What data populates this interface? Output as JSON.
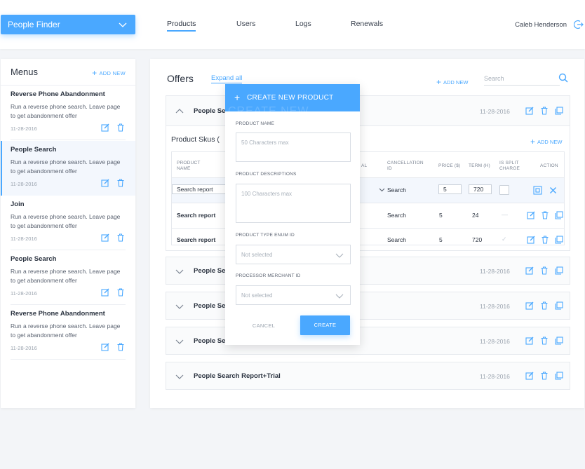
{
  "header": {
    "app_select": "People Finder",
    "tabs": [
      {
        "label": "Products",
        "active": true
      },
      {
        "label": "Users",
        "active": false
      },
      {
        "label": "Logs",
        "active": false
      },
      {
        "label": "Renewals",
        "active": false
      }
    ],
    "user_name": "Caleb Henderson"
  },
  "menus": {
    "title": "Menus",
    "add_label": "ADD NEW",
    "items": [
      {
        "title": "Reverse Phone Abandonment",
        "description": "Run a reverse phone search. Leave page to get abandonment offer",
        "date": "11-28-2016"
      },
      {
        "title": "People Search",
        "description": "Run a reverse phone search. Leave page to get abandonment offer",
        "date": "11-28-2016",
        "active": true
      },
      {
        "title": "Join",
        "description": "Run a reverse phone search. Leave page to get abandonment offer",
        "date": "11-28-2016"
      },
      {
        "title": "People Search",
        "description": "Run a reverse phone search. Leave page to get abandonment offer",
        "date": "11-28-2016"
      },
      {
        "title": "Reverse Phone Abandonment",
        "description": "Run a reverse phone search. Leave page to get abandonment offer",
        "date": "11-28-2016"
      }
    ]
  },
  "offers": {
    "title": "Offers",
    "expand_all": "Expand all",
    "add_label": "ADD NEW",
    "search_placeholder": "Search",
    "rows": [
      {
        "name": "People Se",
        "date": "11-28-2016",
        "expanded": true
      },
      {
        "name": "People Se",
        "date": "11-28-2016"
      },
      {
        "name": "People Se",
        "date": "11-28-2016"
      },
      {
        "name": "People Se",
        "date": "11-28-2016"
      },
      {
        "name": "People Search Report+Trial",
        "date": "11-28-2016"
      }
    ],
    "skus": {
      "title": "Product Skus (",
      "add_label": "ADD NEW",
      "columns": {
        "product_name": "PRODUCT NAME",
        "al": "AL",
        "cancellation_id": "CANCELLATION ID",
        "price": "PRICE ($)",
        "term": "TERM (H)",
        "is_split": "IS SPLIT CHARGE",
        "action": "ACTION"
      },
      "rows": [
        {
          "name": "Search report",
          "cancellation": "Search",
          "price": "5",
          "term": "720",
          "editing": true
        },
        {
          "name": "Search report",
          "cancellation": "Search",
          "price": "5",
          "term": "24",
          "split": "—"
        },
        {
          "name": "Search report",
          "cancellation": "Search",
          "price": "5",
          "term": "720",
          "split": "✓"
        }
      ]
    }
  },
  "modal": {
    "title": "CREATE NEW PRODUCT",
    "ghost_text": "CREATE NEW",
    "product_name_label": "PRODUCT NAME",
    "product_name_placeholder": "50 Characters max",
    "descriptions_label": "PRODUCT DESCRIPTIONS",
    "descriptions_placeholder": "100 Characters max",
    "type_label": "PRODUCT TYPE ENUM ID",
    "type_value": "Not selected",
    "processor_label": "PROCESSOR MERCHANT ID",
    "processor_value": "Not selected",
    "cancel_label": "CANCEL",
    "create_label": "CREATE"
  },
  "colors": {
    "accent": "#4aa8ff",
    "background": "#f3f5f8",
    "text": "#3b4350",
    "muted": "#9aa3ae"
  },
  "icons": [
    "chevron-down-icon",
    "logout-icon",
    "plus-icon",
    "edit-icon",
    "trash-icon",
    "copy-icon",
    "search-icon",
    "save-icon",
    "close-icon",
    "chevron-up-icon"
  ]
}
